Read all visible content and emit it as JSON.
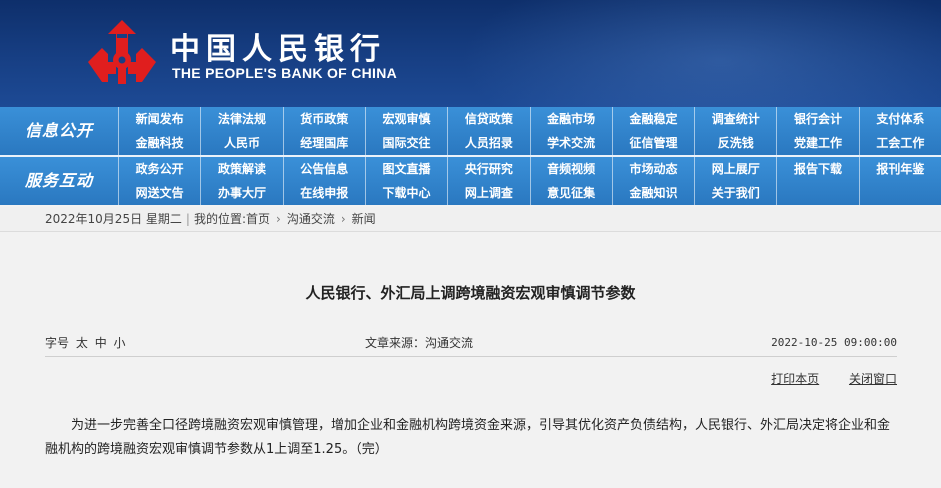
{
  "header": {
    "bank_name_cn": "中国人民银行",
    "bank_name_en": "THE PEOPLE'S BANK OF CHINA",
    "logo_icon": "pboc-emblem-icon",
    "colors": {
      "header_bg": "#173f84",
      "emblem": "#e01e1e",
      "nav_bg": "#2f7fc8"
    }
  },
  "nav": {
    "band1": {
      "label": "信息公开",
      "items": [
        "新闻发布",
        "法律法规",
        "货币政策",
        "宏观审慎",
        "信贷政策",
        "金融市场",
        "金融稳定",
        "调查统计",
        "银行会计",
        "支付体系",
        "金融科技",
        "人民币",
        "经理国库",
        "国际交往",
        "人员招录",
        "学术交流",
        "征信管理",
        "反洗钱",
        "党建工作",
        "工会工作"
      ]
    },
    "band2": {
      "label": "服务互动",
      "items": [
        "政务公开",
        "政策解读",
        "公告信息",
        "图文直播",
        "央行研究",
        "音频视频",
        "市场动态",
        "网上展厅",
        "报告下载",
        "报刊年鉴",
        "网送文告",
        "办事大厅",
        "在线申报",
        "下载中心",
        "网上调查",
        "意见征集",
        "金融知识",
        "关于我们",
        "",
        ""
      ]
    }
  },
  "breadcrumb": {
    "date": "2022年10月25日 星期二",
    "location_label": "我的位置:",
    "home": "首页",
    "section": "沟通交流",
    "current": "新闻"
  },
  "article": {
    "title": "人民银行、外汇局上调跨境融资宏观审慎调节参数",
    "font_size_label": "字号",
    "font_sizes": [
      "太",
      "中",
      "小"
    ],
    "source": "文章来源：沟通交流",
    "datetime": "2022-10-25 09:00:00",
    "print_label": "打印本页",
    "close_label": "关闭窗口",
    "body": "为进一步完善全口径跨境融资宏观审慎管理，增加企业和金融机构跨境资金来源，引导其优化资产负债结构，人民银行、外汇局决定将企业和金融机构的跨境融资宏观审慎调节参数从1上调至1.25。（完）"
  }
}
